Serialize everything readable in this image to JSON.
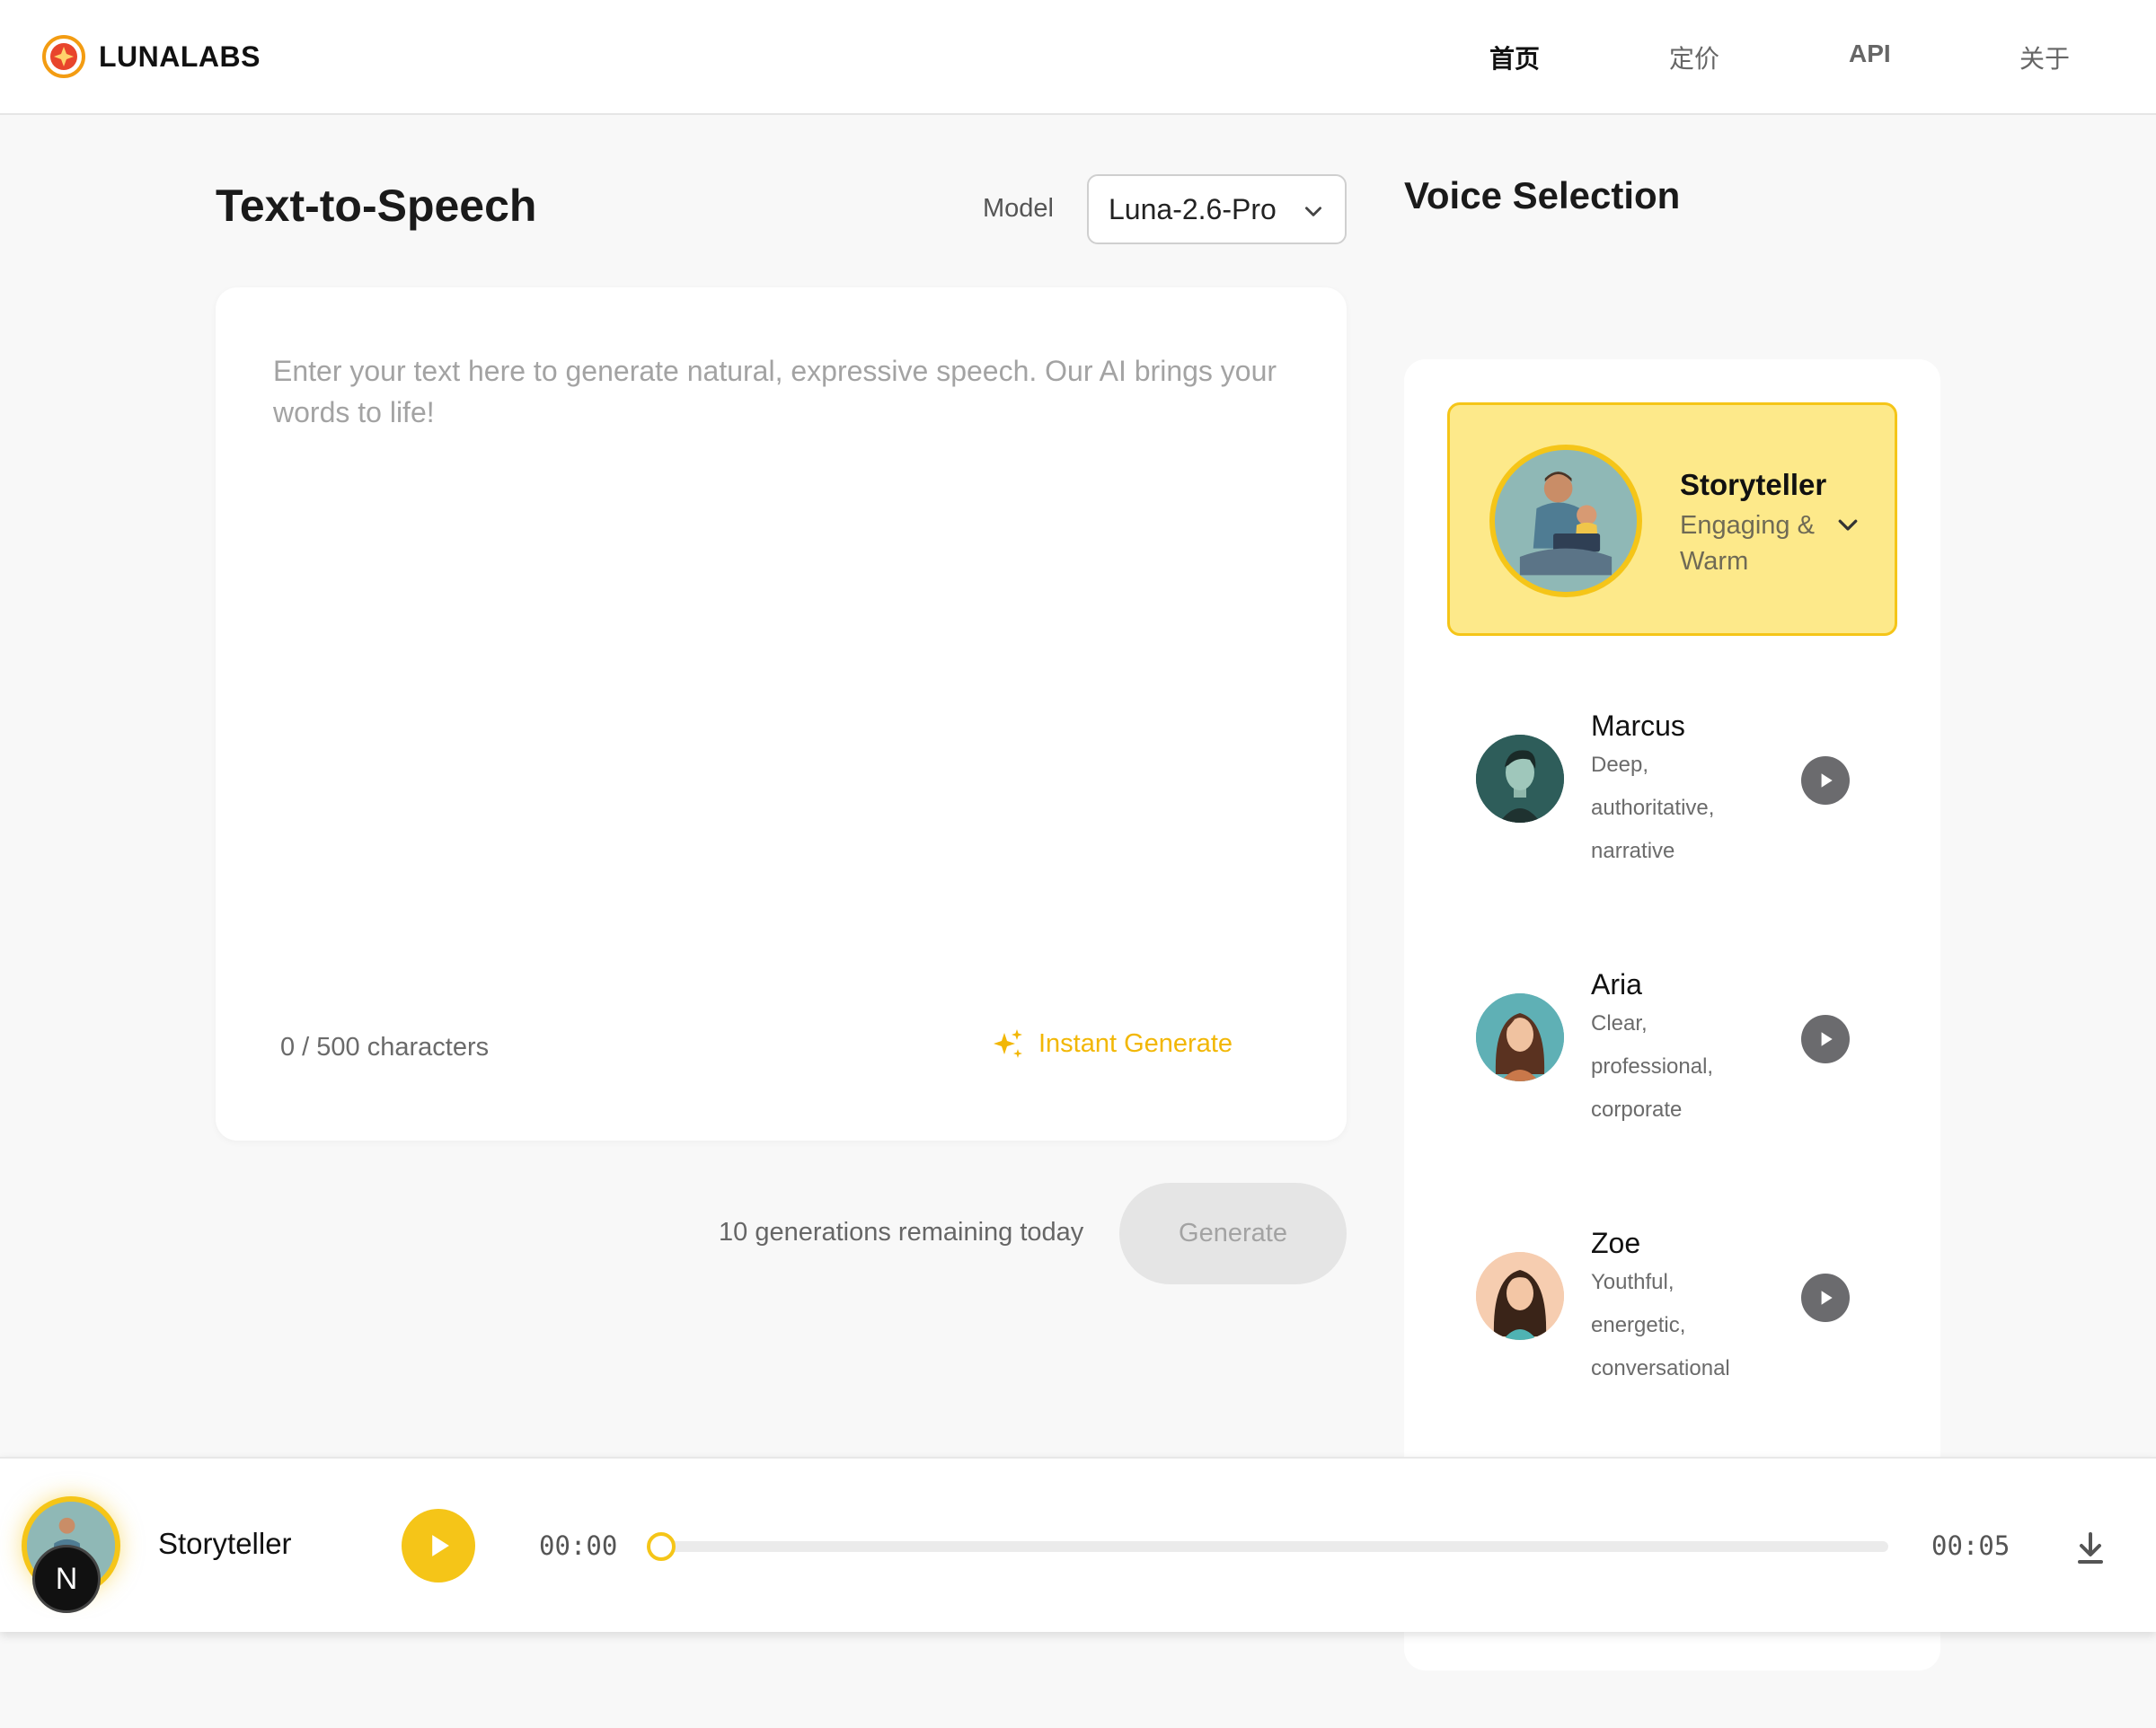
{
  "header": {
    "brand": "LUNALABS",
    "nav": [
      {
        "label": "首页",
        "active": true
      },
      {
        "label": "定价",
        "active": false
      },
      {
        "label": "API",
        "active": false
      },
      {
        "label": "关于",
        "active": false
      }
    ]
  },
  "main": {
    "title": "Text-to-Speech",
    "model_label": "Model",
    "model_value": "Luna-2.6-Pro",
    "placeholder": "Enter your text here to generate natural, expressive speech. Our AI brings your words to life!",
    "char_count": "0 / 500 characters",
    "instant_label": "Instant Generate",
    "remaining": "10 generations remaining today",
    "generate_label": "Generate"
  },
  "voices": {
    "title": "Voice Selection",
    "selected": {
      "name": "Storyteller",
      "desc": "Engaging & Warm"
    },
    "list": [
      {
        "name": "Marcus",
        "desc": "Deep, authoritative, narrative"
      },
      {
        "name": "Aria",
        "desc": "Clear, professional, corporate"
      },
      {
        "name": "Zoe",
        "desc": "Youthful, energetic, conversational"
      }
    ]
  },
  "player": {
    "voice_name": "Storyteller",
    "badge": "N",
    "current_time": "00:00",
    "total_time": "00:05",
    "progress": 0
  },
  "colors": {
    "accent": "#f5c518",
    "selected_bg": "#fde98a",
    "play_icon_bg": "#6b6b6e"
  },
  "icons": [
    "logo-icon",
    "chevron-down-icon",
    "sparkles-icon",
    "play-icon",
    "download-icon"
  ]
}
